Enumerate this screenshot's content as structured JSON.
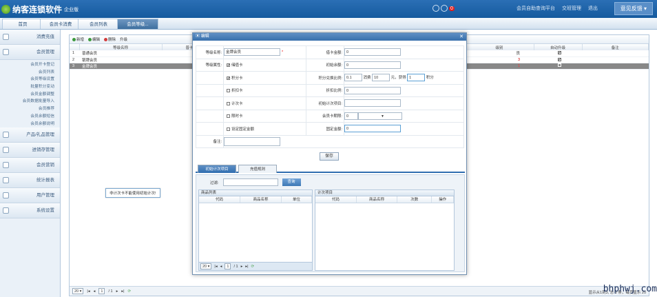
{
  "header": {
    "app_name": "纳客连锁软件",
    "edition": "企业版",
    "badge": "0",
    "links": [
      "会员自助查询平台",
      "交班管理",
      "退出"
    ],
    "feedback": "意见反馈"
  },
  "tabs": [
    "首页",
    "会员卡消费",
    "会员列表",
    "会员等级..."
  ],
  "sidebar": {
    "cats": [
      "消费充值",
      "会员管理"
    ],
    "subs": [
      "会员开卡登记",
      "会员列表",
      "会员等级设置",
      "批量积分变动",
      "会员金额调整",
      "会员数据批量导入",
      "会员推荐",
      "会员余额短信",
      "会员余额说明"
    ],
    "cats2": [
      "产品/礼品管理",
      "进销存管理",
      "会员营销",
      "统计报表",
      "用户管理",
      "系统设置"
    ]
  },
  "main": {
    "toolbar": [
      "新增",
      "编辑",
      "删除",
      "升级"
    ],
    "columns": [
      "等级名称",
      "普卡",
      "",
      "",
      "",
      "",
      "",
      "",
      "级别",
      "自动升级",
      "备注"
    ],
    "rows": [
      {
        "no": "1",
        "name": "普通会员",
        "auto": "✔",
        "tag": "员"
      },
      {
        "no": "2",
        "name": "银牌会员",
        "auto": "✔",
        "tag": "3"
      },
      {
        "no": "3",
        "name": "金牌会员",
        "auto": "",
        "tag": "1"
      }
    ],
    "page_size": "20",
    "page": "1",
    "pages": "/ 1",
    "pageinfo": "显示从1到3, 总 3 条，每页显示 20"
  },
  "dialog": {
    "title": "编辑",
    "fields": {
      "level_name_label": "等级名称:",
      "level_name": "金牌会员",
      "card_fee_label": "借卡金额:",
      "card_fee": "0",
      "attr_label": "等级属性:",
      "stored": "储值卡",
      "init_balance_label": "初始余额:",
      "init_balance": "0",
      "points": "积分卡",
      "rate_label": "积分兑换比例:",
      "rate": "0.1",
      "consume": "消费",
      "consume_val": "10",
      "yuan": "元，获得",
      "get_val": "1",
      "points_unit": "积分",
      "discount": "折扣卡",
      "discount_label": "折扣比例:",
      "discount_val": "0",
      "count": "计次卡",
      "init_count_label": "初始计次项目:",
      "limit": "限时卡",
      "period_label": "会员卡期限:",
      "period_val": "0",
      "fixed": "设定固定金额",
      "fixed_label": "固定金额:",
      "fixed_val": "0",
      "remark_label": "备注:"
    },
    "save": "保存",
    "tabs": [
      "初始计次项目",
      "充值规则"
    ],
    "filter_label": "过滤:",
    "query": "查询",
    "left_grid": {
      "title": "商品列表",
      "cols": [
        "代码",
        "商品名称",
        "单位"
      ]
    },
    "right_grid": {
      "title": "计次项目",
      "cols": [
        "代码",
        "商品名称",
        "次数",
        "操作"
      ]
    },
    "page_size": "20",
    "page": "1",
    "pages": "/ 1",
    "tooltip": "非计次卡不能使用初始计次!"
  },
  "watermark": "bhphwj.com"
}
